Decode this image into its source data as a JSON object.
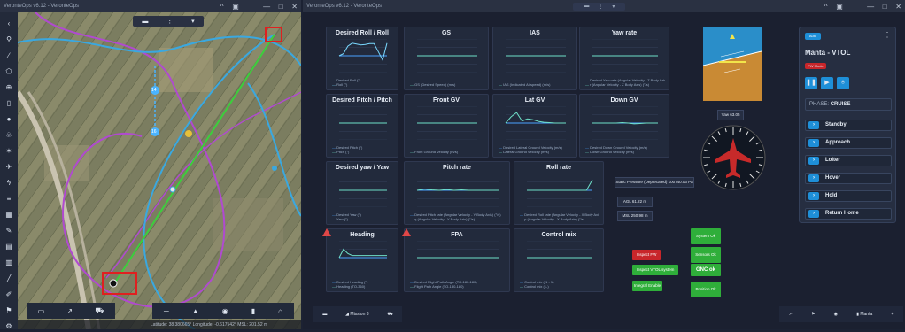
{
  "left_window": {
    "title": "VeronteOps v6.12 - VeronteOps",
    "controls": [
      "^",
      "▣",
      "⋮",
      "—",
      "□",
      "✕"
    ],
    "toolbar_icons": [
      "back-icon",
      "pin-icon",
      "route-icon",
      "polygon-icon",
      "target-icon",
      "phone-icon",
      "circle-icon",
      "tree-icon",
      "sun-icon",
      "plane-icon",
      "bolt-icon",
      "layers-icon",
      "grid-icon",
      "edit-icon",
      "chart-icon",
      "stack-icon",
      "ruler-icon",
      "pen-icon",
      "flag-icon",
      "settings-icon"
    ],
    "map_top_pill": [
      "▬",
      "⋮",
      "▾"
    ],
    "map_bottom_left_icons": [
      "▭",
      "↗",
      "⛟"
    ],
    "map_bottom_right_icons": [
      "─",
      "▲",
      "◉",
      "▮",
      "⌂"
    ],
    "footer_text": "Latitude: 38.380665° Longitude: -0.617542° MSL: 201.52 m",
    "waypoint_labels": [
      "14",
      "16"
    ]
  },
  "right_window": {
    "title": "VeronteOps v6.12 - VeronteOps",
    "top_pill": [
      "▬",
      "⋮",
      "▾"
    ],
    "controls": [
      "^",
      "▣",
      "⋮",
      "—",
      "□",
      "✕"
    ]
  },
  "charts": [
    {
      "id": "desired-roll",
      "title": "Desired Roll / Roll",
      "legend": [
        "Desired Roll (°)",
        "Roll (°)"
      ],
      "colors": [
        "#4aa3ff",
        "#7ad9ff"
      ],
      "series": [
        [
          0,
          0,
          0,
          0,
          0,
          0,
          0,
          0,
          0,
          0,
          0,
          0
        ],
        [
          0,
          0.5,
          2.3,
          3,
          2.8,
          2.6,
          2.7,
          2.9,
          2.9,
          1,
          -1,
          3
        ]
      ],
      "ylim": [
        -4,
        4
      ]
    },
    {
      "id": "gs",
      "title": "GS",
      "legend": [
        "GS (Desired Speed) (m/s)"
      ],
      "colors": [
        "#6fe0c8"
      ],
      "series": [
        [
          0,
          0,
          0,
          0,
          0,
          0,
          0,
          0,
          0,
          0,
          0,
          0
        ]
      ],
      "ylim": [
        -4,
        4
      ]
    },
    {
      "id": "ias",
      "title": "IAS",
      "legend": [
        "IAS (Indicated Airspeed) (m/s)"
      ],
      "colors": [
        "#6fe0c8"
      ],
      "series": [
        [
          0,
          0,
          0,
          0,
          0,
          0,
          0,
          0,
          0,
          0,
          0,
          0
        ]
      ],
      "ylim": [
        -4,
        4
      ]
    },
    {
      "id": "yaw-rate",
      "title": "Yaw rate",
      "legend": [
        "Desired Yaw rate (Angular Velocity - Z Body Axis) (°/s)",
        "r (Angular Velocity - Z Body Axis) (°/s)"
      ],
      "colors": [
        "#4aa3ff",
        "#6fe0c8"
      ],
      "series": [
        [
          0,
          0,
          0,
          0,
          0,
          0,
          0,
          0,
          0,
          0,
          0,
          0
        ],
        [
          0,
          0,
          0,
          0,
          0,
          0,
          0,
          0,
          0,
          0,
          0,
          0
        ]
      ],
      "ylim": [
        -4,
        4
      ]
    },
    {
      "id": "desired-pitch",
      "title": "Desired Pitch / Pitch",
      "legend": [
        "Desired Pitch (°)",
        "Pitch (°)"
      ],
      "colors": [
        "#4aa3ff",
        "#6fe0c8"
      ],
      "series": [
        [
          0,
          0,
          0,
          0,
          0,
          0,
          0,
          0,
          0,
          0,
          0,
          0
        ],
        [
          0,
          0,
          0,
          0,
          0,
          0,
          0,
          0,
          0,
          0,
          0,
          0
        ]
      ],
      "ylim": [
        -4,
        4
      ]
    },
    {
      "id": "front-gv",
      "title": "Front GV",
      "legend": [
        "Front Ground Velocity (m/s)"
      ],
      "colors": [
        "#6fe0c8"
      ],
      "series": [
        [
          0,
          0,
          0,
          0,
          0,
          0,
          0,
          0,
          0,
          0,
          0,
          0
        ]
      ],
      "ylim": [
        -4,
        4
      ]
    },
    {
      "id": "lat-gv",
      "title": "Lat GV",
      "legend": [
        "Desired Lateral Ground Velocity (m/s)",
        "Lateral Ground Velocity (m/s)"
      ],
      "colors": [
        "#4aa3ff",
        "#6fe0c8"
      ],
      "series": [
        [
          0,
          0,
          0,
          0,
          0,
          0,
          0,
          0,
          0,
          0,
          0,
          0
        ],
        [
          0,
          1.5,
          2.5,
          0.5,
          1,
          0.8,
          0.4,
          0.2,
          0.1,
          0,
          0,
          0
        ]
      ],
      "ylim": [
        -4,
        4
      ]
    },
    {
      "id": "down-gv",
      "title": "Down GV",
      "legend": [
        "Desired Down Ground Velocity (m/s)",
        "Down Ground Velocity (m/s)"
      ],
      "colors": [
        "#4aa3ff",
        "#6fe0c8"
      ],
      "series": [
        [
          0,
          0,
          0,
          0,
          0,
          0,
          0,
          0,
          0,
          0,
          0,
          0
        ],
        [
          0,
          0,
          0,
          0,
          0,
          0.1,
          0,
          -0.2,
          -0.1,
          0,
          0,
          0
        ]
      ],
      "ylim": [
        -4,
        4
      ]
    },
    {
      "id": "desired-yaw",
      "title": "Desired yaw / Yaw",
      "legend": [
        "Desired Yaw (°)",
        "Yaw (°)"
      ],
      "colors": [
        "#4aa3ff",
        "#6fe0c8"
      ],
      "series": [
        [
          0,
          0,
          0,
          0,
          0,
          0,
          0,
          0,
          0,
          0,
          0,
          0
        ],
        [
          0,
          0,
          0,
          0,
          0,
          0,
          0,
          0,
          0,
          0,
          0,
          0
        ]
      ],
      "ylim": [
        -4,
        4
      ]
    },
    {
      "id": "pitch-rate",
      "title": "Pitch rate",
      "legend": [
        "Desired Pitch rate (Angular Velocity - Y Body Axis) (°/s)",
        "q (Angular Velocity - Y Body Axis) (°/s)"
      ],
      "colors": [
        "#4aa3ff",
        "#6fe0c8"
      ],
      "series": [
        [
          0,
          0,
          0,
          0,
          0,
          0,
          0,
          0,
          0,
          0,
          0,
          0
        ],
        [
          0,
          0.3,
          0.1,
          0,
          0.2,
          0,
          0.1,
          0,
          0,
          0,
          0,
          0
        ]
      ],
      "ylim": [
        -4,
        4
      ]
    },
    {
      "id": "roll-rate",
      "title": "Roll rate",
      "legend": [
        "Desired Roll rate (Angular Velocity - X Body Axis) (°/s)",
        "p (Angular Velocity - X Body Axis) (°/s)"
      ],
      "colors": [
        "#4aa3ff",
        "#6fe0c8"
      ],
      "series": [
        [
          0,
          0,
          0,
          0,
          0,
          0,
          0,
          0,
          0,
          0,
          0,
          0
        ],
        [
          0,
          0,
          0,
          0,
          0,
          0,
          0,
          0,
          0,
          0,
          0,
          2.5
        ]
      ],
      "ylim": [
        -4,
        4
      ]
    },
    {
      "id": "heading",
      "title": "Heading",
      "legend": [
        "Desired Heading (°)",
        "Heading (TO-360)"
      ],
      "colors": [
        "#4aa3ff",
        "#6fe0c8"
      ],
      "series": [
        [
          0,
          0,
          0,
          0,
          0,
          0,
          0,
          0,
          0,
          0,
          0,
          0
        ],
        [
          0,
          2,
          1,
          0.5,
          0.5,
          0.5,
          0.5,
          0.5,
          0.5,
          0.5,
          0.5,
          0.5
        ]
      ],
      "ylim": [
        -4,
        4
      ]
    },
    {
      "id": "fpa",
      "title": "FPA",
      "legend": [
        "Desired Flight Path Angle (TO-180-180)",
        "Flight Path Angle (TO-180-180)"
      ],
      "colors": [
        "#4aa3ff",
        "#6fe0c8"
      ],
      "series": [
        [
          0,
          0,
          0,
          0,
          0,
          0,
          0,
          0,
          0,
          0,
          0,
          0
        ],
        [
          0,
          0,
          0,
          0,
          0,
          0,
          0,
          0,
          0,
          0,
          0,
          0
        ]
      ],
      "ylim": [
        -4,
        4
      ]
    },
    {
      "id": "control-mix",
      "title": "Control mix",
      "legend": [
        "Control mix (-1 - 1)",
        "Control mix (1-)"
      ],
      "colors": [
        "#4aa3ff",
        "#6fe0c8"
      ],
      "series": [
        [
          0,
          0,
          0,
          0,
          0,
          0,
          0,
          0,
          0,
          0,
          0,
          0
        ],
        [
          0,
          0,
          0,
          0,
          0,
          0,
          0,
          0,
          0,
          0,
          0,
          0
        ]
      ],
      "ylim": [
        -4,
        4
      ]
    }
  ],
  "info": {
    "static_pressure": "Static Pressure (Deprecated) 100740.03 Pa",
    "agl": "AGL 61.22 m",
    "msl": "MSL 250.98 m",
    "yaw": "Yaw 63.05"
  },
  "status_buttons": {
    "inspect_fw": "Inspect FW",
    "inspect_vtol": "Inspect VTOL system",
    "integral_enable": "Integral Enable",
    "system_ok": "System Ok",
    "sensors_ok": "Sensors Ok",
    "gnc_ok": "GNC ok",
    "position_ok": "Position Ok",
    "colors": {
      "red": "#c8262a",
      "green": "#2fae3a"
    }
  },
  "mission_panel": {
    "auto_badge": "Auto",
    "name": "Manta - VTOL",
    "fw_mode": "FW Mode",
    "phase_label": "PHASE:",
    "phase_value": "CRUISE",
    "items": [
      "Standby",
      "Approach",
      "Loiter",
      "Hover",
      "Hold",
      "Return Home"
    ],
    "accent": "#1e8fd8"
  },
  "bottom_bar": {
    "mission_label": "Mission 3",
    "manta_label": "Manta"
  }
}
